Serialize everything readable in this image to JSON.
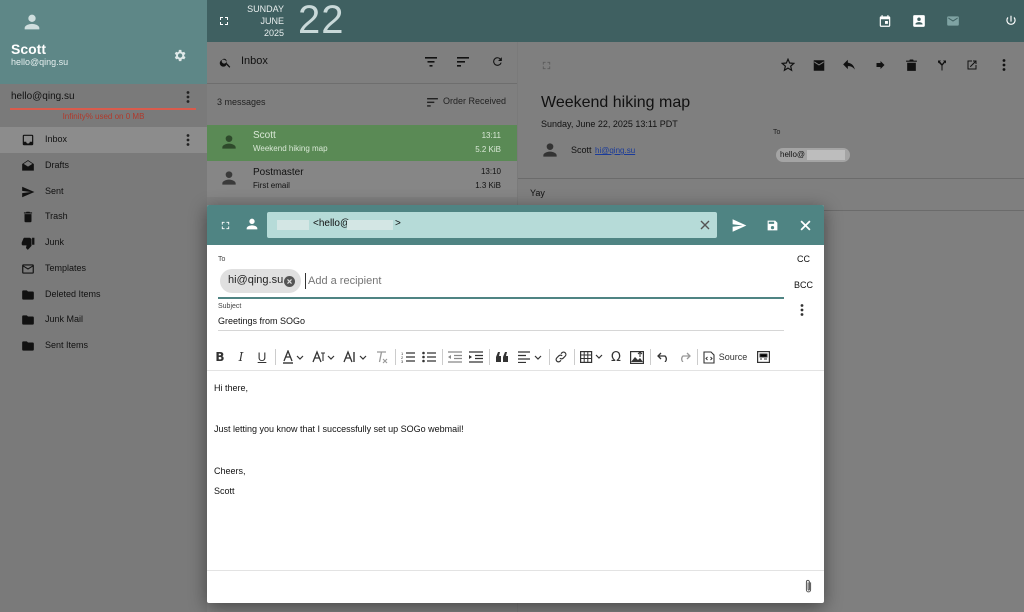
{
  "user": {
    "name": "Scott",
    "email": "hello@qing.su"
  },
  "header": {
    "weekday": "SUNDAY",
    "month": "JUNE",
    "year": "2025",
    "day": "22"
  },
  "sidebar": {
    "account": "hello@qing.su",
    "quota": "Infinity% used on 0 MB",
    "folders": [
      {
        "label": "Inbox",
        "icon": "inbox-icon"
      },
      {
        "label": "Drafts",
        "icon": "drafts-icon"
      },
      {
        "label": "Sent",
        "icon": "send-icon"
      },
      {
        "label": "Trash",
        "icon": "trash-icon"
      },
      {
        "label": "Junk",
        "icon": "thumb-down-icon"
      },
      {
        "label": "Templates",
        "icon": "envelope-icon"
      },
      {
        "label": "Deleted Items",
        "icon": "folder-icon"
      },
      {
        "label": "Junk Mail",
        "icon": "folder-icon"
      },
      {
        "label": "Sent Items",
        "icon": "folder-icon"
      }
    ]
  },
  "list": {
    "title": "Inbox",
    "count": "3 messages",
    "sort": "Order Received",
    "messages": [
      {
        "sender": "Scott",
        "subject": "Weekend hiking map",
        "time": "13:11",
        "size": "5.2 KiB"
      },
      {
        "sender": "Postmaster",
        "subject": "First email",
        "time": "13:10",
        "size": "1.3 KiB"
      }
    ]
  },
  "reader": {
    "subject": "Weekend hiking map",
    "date": "Sunday, June 22, 2025 13:11 PDT",
    "from_name": "Scott",
    "from_email": "hi@qing.su",
    "to_label": "To",
    "to_value": "hello@",
    "body": "Yay"
  },
  "compose": {
    "from_value": "<hello@",
    "from_end": ">",
    "to_label": "To",
    "recipient": "hi@qing.su",
    "recipient_placeholder": "Add a recipient",
    "cc": "CC",
    "bcc": "BCC",
    "subject_label": "Subject",
    "subject": "Greetings from SOGo",
    "source_label": "Source",
    "body_lines": [
      "Hi there,",
      "",
      "Just letting you know that I successfully set up SOGo webmail!",
      "",
      "Cheers,",
      "Scott"
    ]
  }
}
